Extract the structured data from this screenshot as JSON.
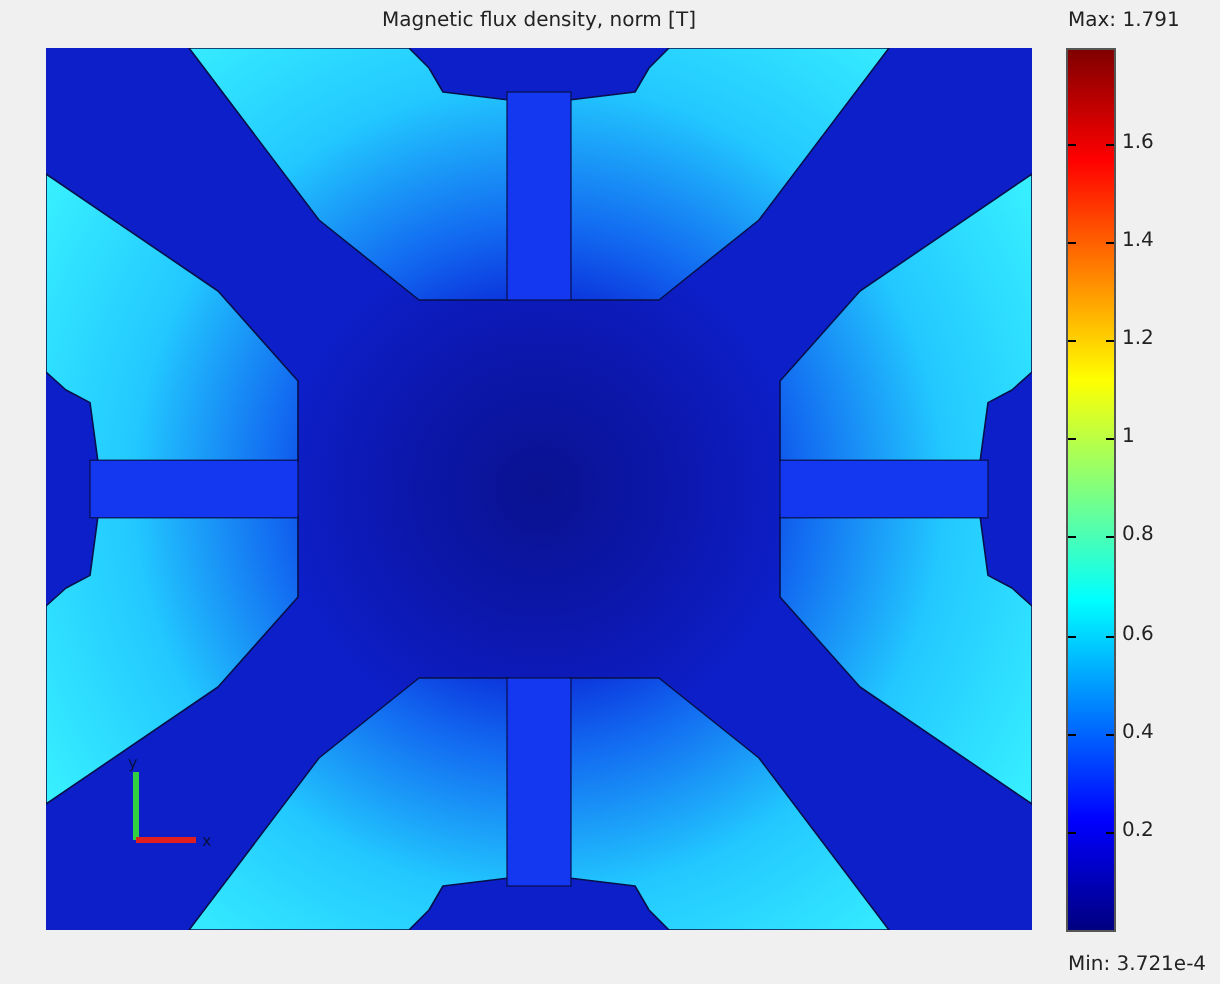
{
  "plot": {
    "title": "Magnetic flux density, norm [T]",
    "axes": {
      "x_label": "x",
      "y_label": "y"
    }
  },
  "colorbar": {
    "max_label": "Max: 1.791",
    "min_label": "Min: 3.721e-4",
    "ticks": [
      {
        "label": "1.6",
        "level": 0.8933
      },
      {
        "label": "1.4",
        "level": 0.7817
      },
      {
        "label": "1.2",
        "level": 0.67
      },
      {
        "label": "1",
        "level": 0.5583
      },
      {
        "label": "0.8",
        "level": 0.4467
      },
      {
        "label": "0.6",
        "level": 0.335
      },
      {
        "label": "0.4",
        "level": 0.2233
      },
      {
        "label": "0.2",
        "level": 0.1117
      }
    ]
  }
}
